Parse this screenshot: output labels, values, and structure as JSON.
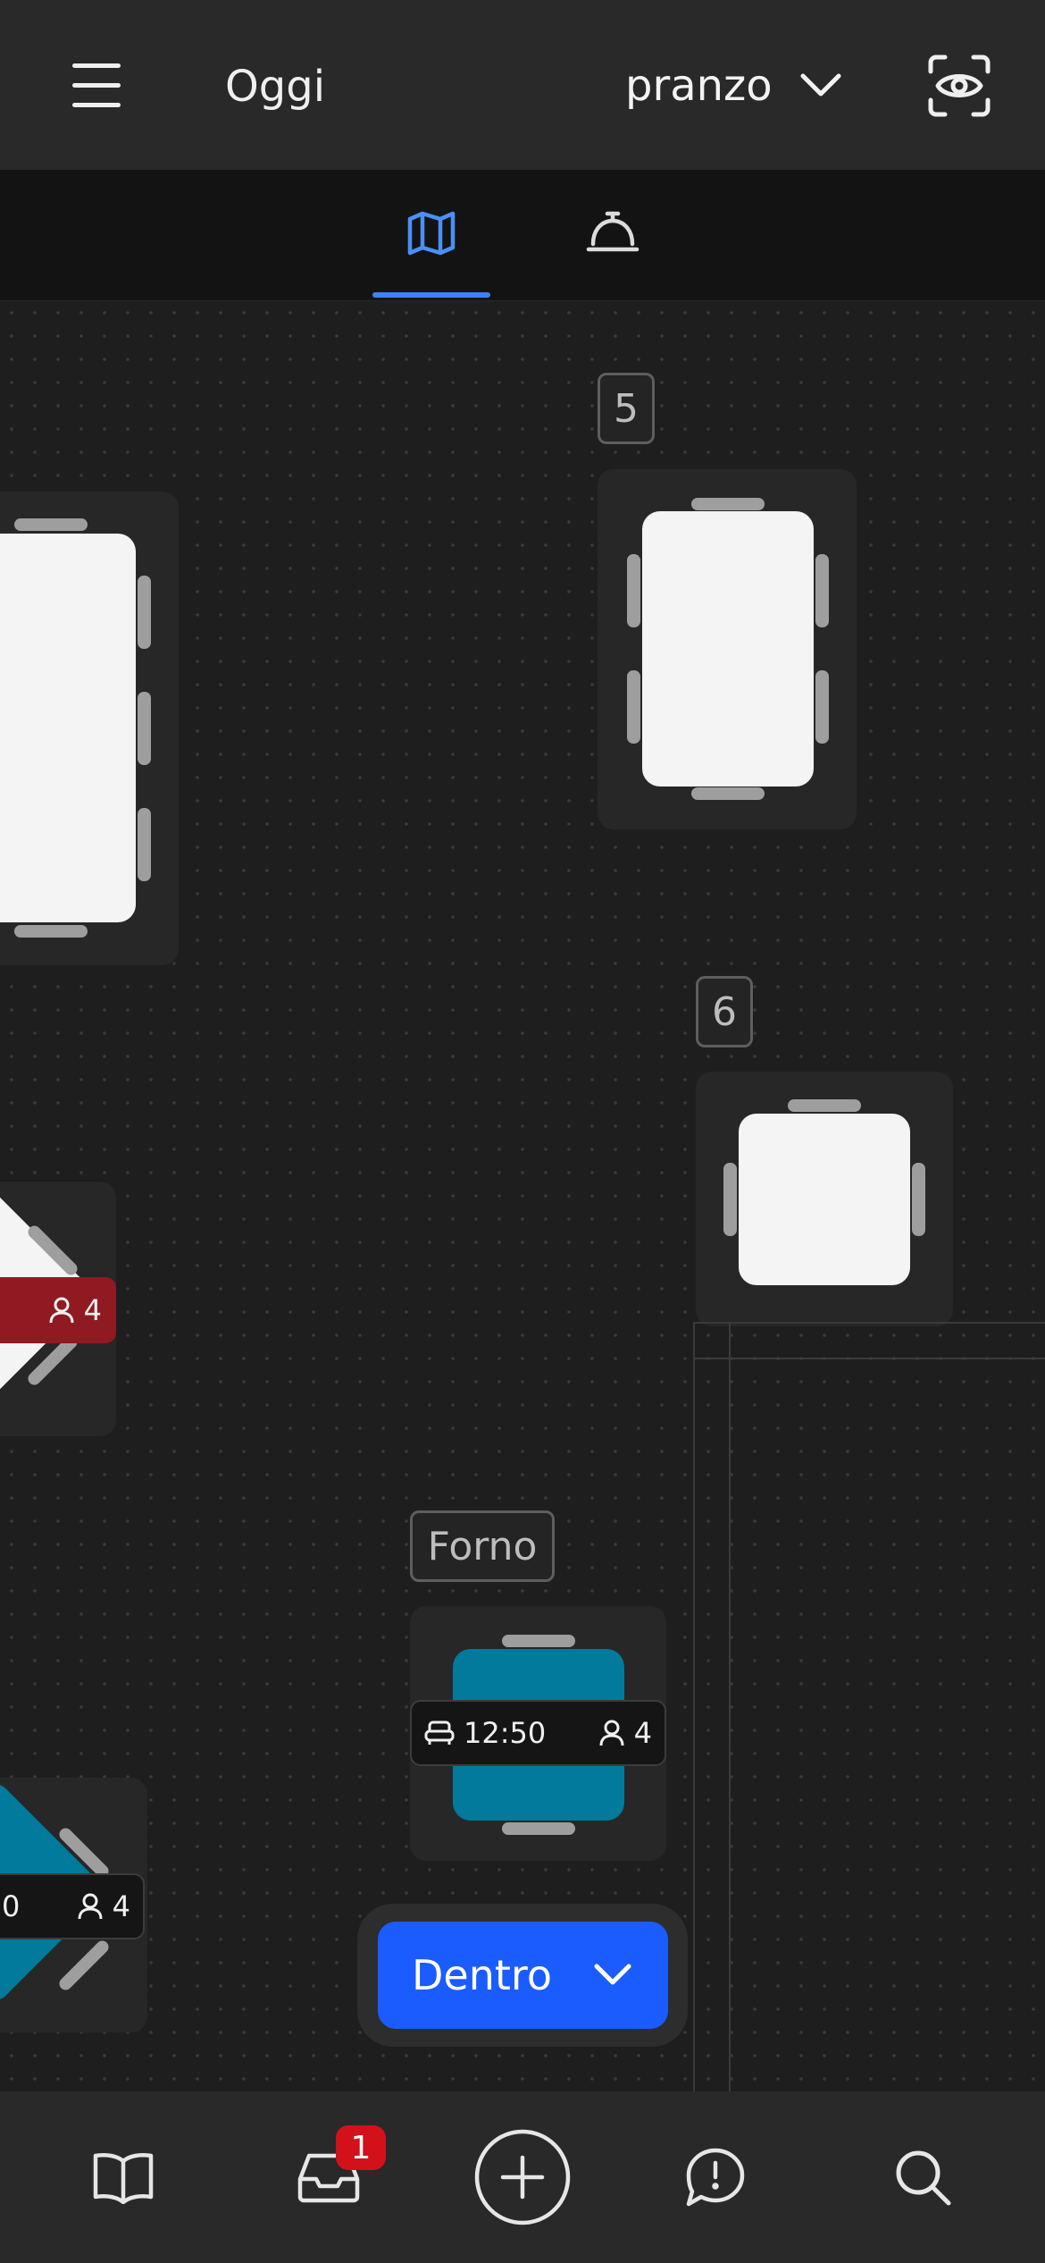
{
  "header": {
    "date_label": "Oggi",
    "service_label": "pranzo"
  },
  "tabs": [
    {
      "name": "map",
      "icon": "map-icon",
      "active": true
    },
    {
      "name": "service",
      "icon": "service-bell-icon",
      "active": false
    }
  ],
  "floor": {
    "table_labels": {
      "table_5": "5",
      "table_6": "6",
      "forno": "Forno"
    },
    "reservations": [
      {
        "id": "left-red",
        "guests": "4",
        "color": "#8f1a21"
      },
      {
        "id": "forno",
        "time": "12:50",
        "guests": "4",
        "color": "#017a9c"
      },
      {
        "id": "left-bottom",
        "time_fragment": "0",
        "guests": "4",
        "color": "#017a9c"
      }
    ]
  },
  "area_selector": {
    "label": "Dentro"
  },
  "bottom_nav": {
    "items": [
      "book-icon",
      "inbox-icon",
      "add-circle-icon",
      "chat-alert-icon",
      "search-icon"
    ],
    "inbox_badge": "1"
  },
  "colors": {
    "accent": "#3b82f6",
    "primary_button": "#1a5cff",
    "badge": "#d2111b",
    "teal_table": "#017a9c",
    "red_reservation": "#8f1a21"
  }
}
